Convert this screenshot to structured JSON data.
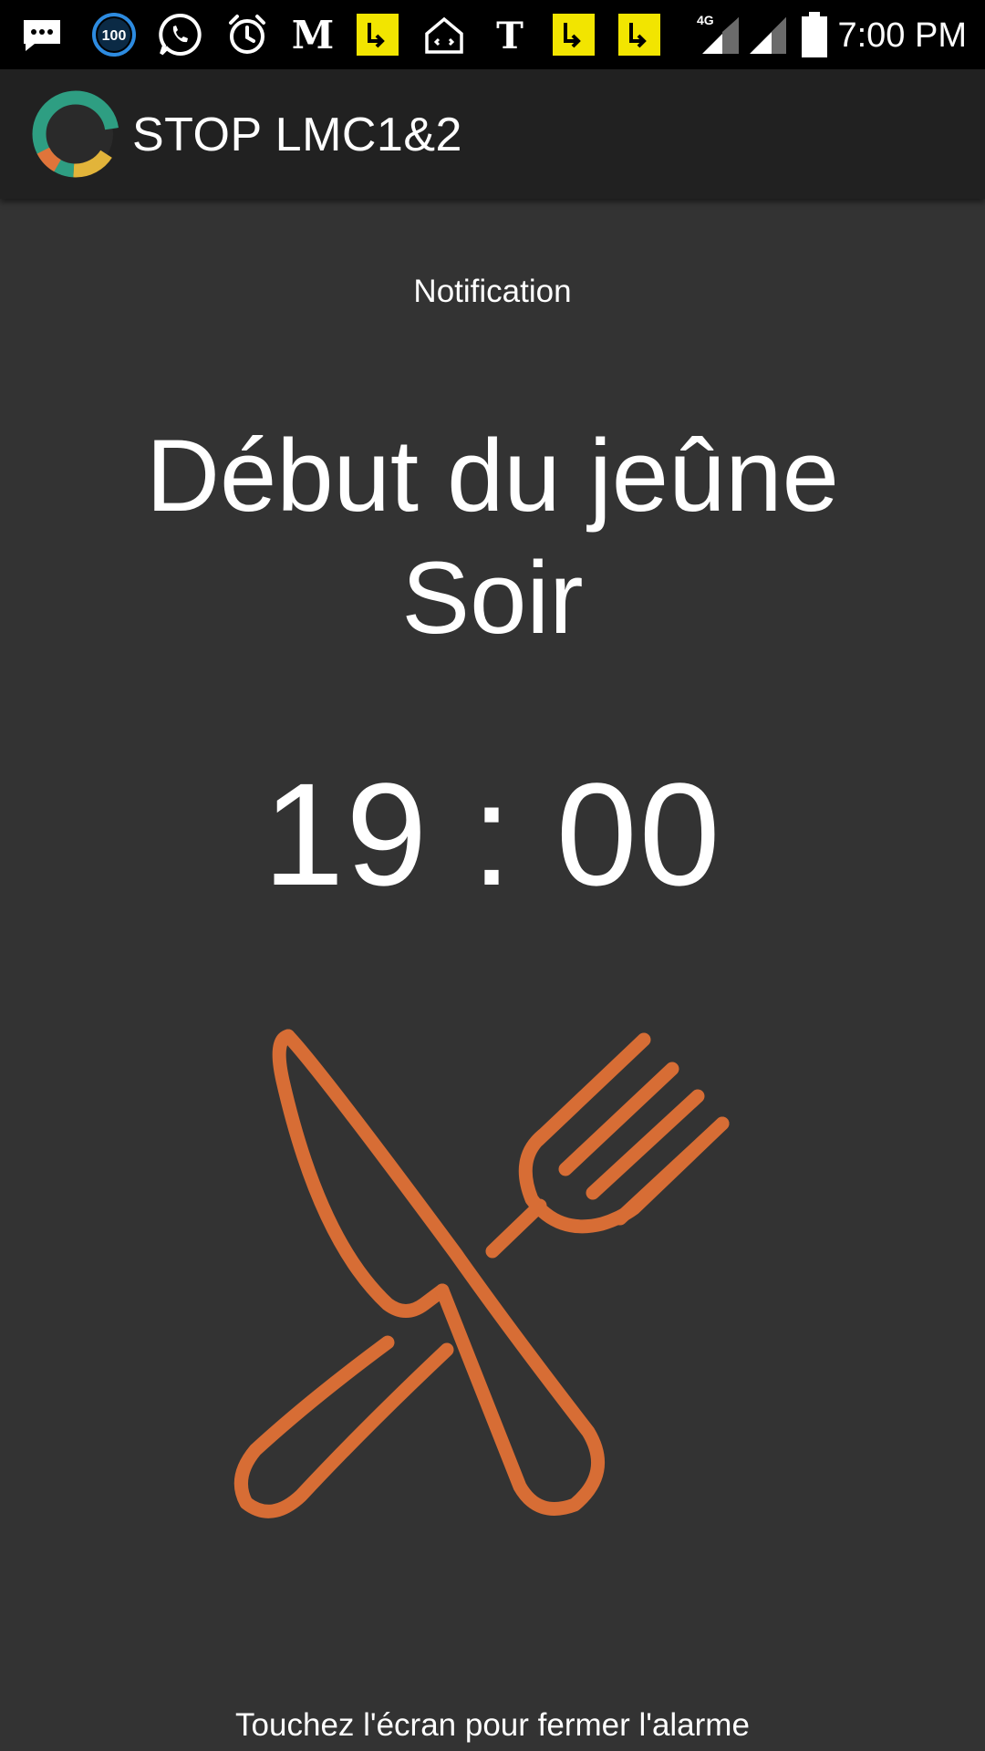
{
  "status_bar": {
    "time": "7:00 PM",
    "network_label": "4G",
    "badge_number": "100",
    "icons": [
      "message-bubble-icon",
      "badge-100-icon",
      "whatsapp-icon",
      "alarm-clock-icon",
      "le-monde-icon",
      "yellow-app-icon",
      "home-app-icon",
      "nyt-icon",
      "yellow-app-icon",
      "yellow-app-icon",
      "signal-4g-icon",
      "signal-icon",
      "battery-icon"
    ]
  },
  "app_bar": {
    "title": "STOP LMC1&2",
    "logo_icon": "app-logo-ring-icon"
  },
  "notification": {
    "label": "Notification",
    "title_line1": "Début du jeûne",
    "title_line2": "Soir",
    "time": "19 : 00",
    "illustration_icon": "knife-fork-icon",
    "dismiss_hint": "Touchez l'écran pour fermer l'alarme"
  },
  "colors": {
    "background": "#333333",
    "app_bar": "#212121",
    "status_bar": "#000000",
    "accent_orange": "#D76D35",
    "logo_green": "#2E9E82",
    "logo_yellow": "#E2B43A",
    "logo_orange": "#E0743A",
    "text": "#FFFFFF"
  }
}
